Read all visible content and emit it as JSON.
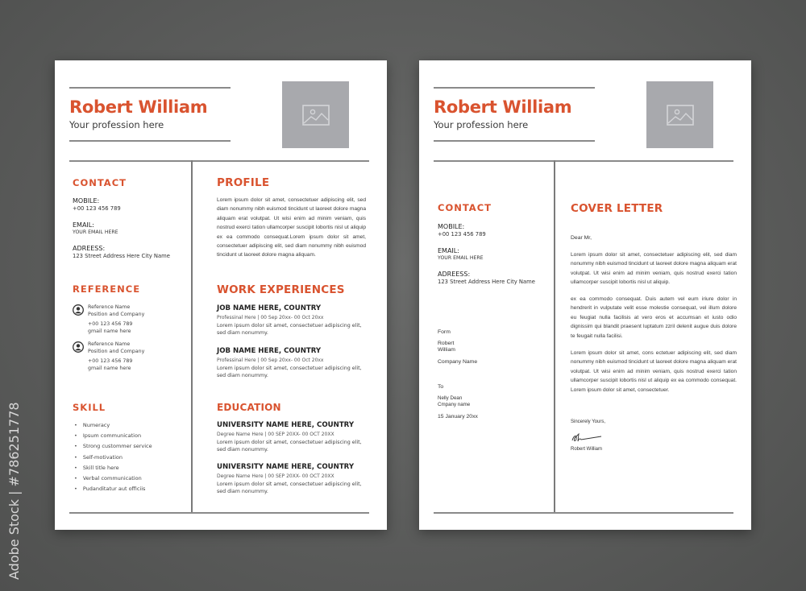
{
  "colors": {
    "accent": "#d9532f",
    "background": "#5a5b5a",
    "photo_placeholder": "#a8a9ad",
    "rule": "#8a8a8a"
  },
  "watermark": "Adobe Stock | #786251778",
  "resume": {
    "name": "Robert William",
    "profession": "Your profession here",
    "photo_icon": "image-placeholder-icon",
    "contact": {
      "title": "CONTACT",
      "mobile_label": "MOBILE:",
      "mobile_value": "+00 123 456 789",
      "email_label": "EMAIL:",
      "email_value": "YOUR EMAIL HERE",
      "address_label": "ADREESS:",
      "address_value": "123 Street Address Here City Name"
    },
    "reference": {
      "title": "REFERENCE",
      "items": [
        {
          "name": "Reference Name",
          "position": "Position and Company",
          "phone": "+00 123 456 789",
          "email": "gmail name here"
        },
        {
          "name": "Reference Name",
          "position": "Position and Company",
          "phone": "+00 123 456 789",
          "email": "gmail name here"
        }
      ]
    },
    "skill": {
      "title": "SKILL",
      "items": [
        "Numeracy",
        "Ipsum communication",
        "Strong custommer service",
        "Self-motivation",
        "Skill title here",
        "Verbal communication",
        "Pudanditatur aut officiis"
      ]
    },
    "profile": {
      "title": "PROFILE",
      "text": "Lorem ipsum dolor sit amet, consectetuer adipiscing elit, sed diam nonummy nibh euismod tincidunt ut laoreet dolore magna aliquam erat volutpat. Ut wisi enim ad minim veniam, quis nostrud exerci tation ullamcorper suscipit lobortis nisl ut aliquip ex ea commodo consequat.Lorem ipsum dolor sit amet, consectetuer adipiscing elit, sed diam nonummy nibh euismod tincidunt ut laoreet dolore magna aliquam."
    },
    "work": {
      "title": "WORK EXPERIENCES",
      "items": [
        {
          "title": "JOB NAME HERE, COUNTRY",
          "meta": "Professinal Here  |  00 Sep 20xx- 00 Oct 20xx",
          "desc": "Lorem ipsum dolor sit amet, consectetuer adipiscing elit, sed diam nonummy."
        },
        {
          "title": "JOB NAME HERE, COUNTRY",
          "meta": "Professinal Here  |  00 Sep 20xx- 00 Oct 20xx",
          "desc": "Lorem ipsum dolor sit amet, consectetuer adipiscing elit, sed diam nonummy."
        }
      ]
    },
    "education": {
      "title": "EDUCATION",
      "items": [
        {
          "title": "UNIVERSITY NAME HERE, COUNTRY",
          "meta": "Degree Name Here |  00 SEP 20XX- 00 OCT 20XX",
          "desc": "Lorem ipsum dolor sit amet, consectetuer adipiscing elit, sed diam nonummy."
        },
        {
          "title": "UNIVERSITY NAME HERE, COUNTRY",
          "meta": "Degree Name Here |  00 SEP 20XX- 00 OCT 20XX",
          "desc": "Lorem ipsum dolor sit amet, consectetuer adipiscing elit, sed diam nonummy."
        }
      ]
    }
  },
  "cover": {
    "name": "Robert William",
    "profession": "Your profession here",
    "contact": {
      "title": "CONTACT",
      "mobile_label": "MOBILE:",
      "mobile_value": "+00 123 456 789",
      "email_label": "EMAIL:",
      "email_value": "YOUR EMAIL HERE",
      "address_label": "ADREESS:",
      "address_value": "123 Street Address Here City Name"
    },
    "from_label": "Form",
    "from_name_1": "Robert",
    "from_name_2": "William",
    "from_company": "Company Name",
    "to_label": "To",
    "to_name": "Nelly Dean",
    "to_company": "Cmpany name",
    "date": "15 January 20xx",
    "title": "COVER LETTER",
    "salutation": "Dear Mr,",
    "paragraphs": [
      "Lorem ipsum dolor sit amet, consectetuer adipiscing elit, sed diam nonummy nibh euismod tincidunt ut laoreet dolore magna aliquam erat volutpat. Ut wisi enim ad minim veniam, quis nostrud exerci tation ullamcorper suscipit lobortis nisl ut aliquip.",
      "ex ea commodo consequat. Duis autem vel eum iriure dolor in hendrerit in vulputate velit esse molestie consequat, vel illum dolore eu feugiat nulla facilisis at vero eros et accumsan et iusto odio dignissim qui blandit praesent luptatum zzril delenit augue duis dolore te feugait nulla facilisi.",
      "Lorem ipsum dolor sit amet, cons ectetuer adipiscing elit, sed diam nonummy nibh euismod tincidunt ut laoreet dolore magna aliquam erat volutpat. Ut wisi enim ad minim veniam, quis nostrud exerci tation ullamcorper suscipit lobortis nisl ut aliquip ex ea commodo consequat. Lorem ipsum dolor sit amet, consectetuer."
    ],
    "closing": "Sincerely Yours,",
    "signature_icon": "signature-icon",
    "signer": "Robert William"
  }
}
